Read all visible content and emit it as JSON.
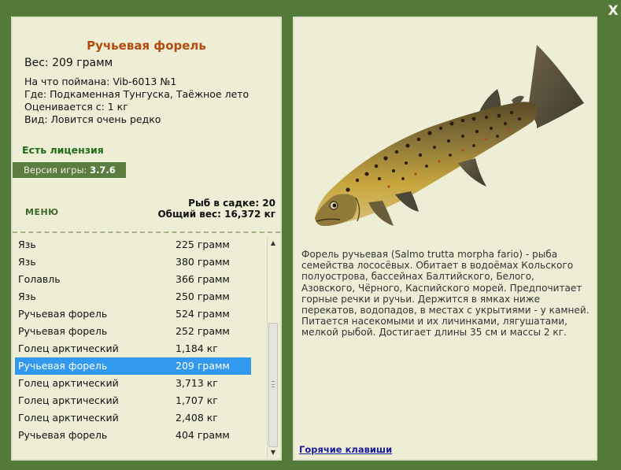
{
  "close_label": "X",
  "fish": {
    "title": "Ручьевая форель",
    "weight": "Вес: 209 грамм",
    "caught_with": "На что поймана: Vib-6013 №1",
    "location": "Где: Подкаменная Тунгуска, Таёжное лето",
    "valued_from": "Оценивается с: 1 кг",
    "rarity": "Вид: Ловится очень редко"
  },
  "license": "Есть лицензия",
  "version": {
    "label": "Версия игры:",
    "value": "3.7.6"
  },
  "menu_label": "МЕНЮ",
  "keep": {
    "count": "Рыб в садке: 20",
    "total_weight": "Общий вес: 16,372 кг"
  },
  "fish_list": [
    {
      "name": "Язь",
      "weight": "225 грамм"
    },
    {
      "name": "Язь",
      "weight": "380 грамм"
    },
    {
      "name": "Голавль",
      "weight": "366 грамм"
    },
    {
      "name": "Язь",
      "weight": "250 грамм"
    },
    {
      "name": "Ручьевая форель",
      "weight": "524 грамм"
    },
    {
      "name": "Ручьевая форель",
      "weight": "252 грамм"
    },
    {
      "name": "Голец арктический",
      "weight": "1,184 кг"
    },
    {
      "name": "Ручьевая форель",
      "weight": "209 грамм"
    },
    {
      "name": "Голец арктический",
      "weight": "3,713 кг"
    },
    {
      "name": "Голец арктический",
      "weight": "1,707 кг"
    },
    {
      "name": "Голец арктический",
      "weight": "2,408 кг"
    },
    {
      "name": "Ручьевая форель",
      "weight": "404 грамм"
    }
  ],
  "selected_index": 7,
  "description": "Форель ручьевая (Salmo trutta morpha fario) - рыба семейства лососёвых. Обитает в водоёмах Кольского полуострова, бассейнах Балтийского, Белого, Азовского, Чёрного, Каспийского морей. Предпочитает горные речки и ручьи. Держится в ямках ниже перекатов, водопадов, в местах с укрытиями - у камней. Питается насекомыми и их личинками, лягушатами, мелкой рыбой. Достигает длины 35 см и массы 2 кг.",
  "hotkeys_link": "Горячие клавиши",
  "colors": {
    "background": "#547a3a",
    "panel": "#eeeed6",
    "title": "#b34a0e",
    "license": "#1f6d18",
    "selection": "#3399ee",
    "link": "#1a1a9c"
  },
  "icons": {
    "close": "close-icon",
    "scroll_up": "scroll-up-arrow-icon",
    "scroll_down": "scroll-down-arrow-icon"
  }
}
